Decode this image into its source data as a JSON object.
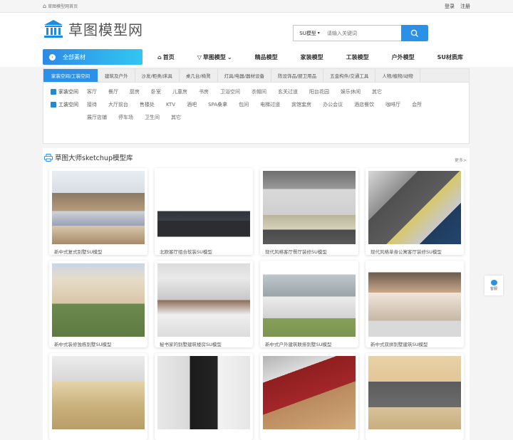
{
  "topbar": {
    "home_link": "草图模型网首页",
    "login": "登录",
    "register": "注册"
  },
  "header": {
    "logo_text": "草图模型网"
  },
  "search": {
    "category": "SU模型",
    "placeholder": "请输入关键词"
  },
  "nav": {
    "all_materials": "全部素材",
    "links": [
      "首页",
      "草图模型",
      "精品模型",
      "家装模型",
      "工装模型",
      "户外模型",
      "SU材质库"
    ]
  },
  "category_tabs": [
    "家装空间/工装空间",
    "建筑及户外",
    "沙发/柜类/床具",
    "桌几台/椅凳",
    "灯具/电器/器材设备",
    "陈设饰品/厨卫用品",
    "五金构件/交通工具",
    "人物/植物/动物"
  ],
  "category_panel": {
    "home": {
      "label": "家装空间",
      "items": [
        "客厅",
        "餐厅",
        "厨房",
        "卧室",
        "儿童房",
        "书房",
        "卫浴空间",
        "衣帽间",
        "玄关过道",
        "阳台花园",
        "娱乐休闲",
        "其它"
      ]
    },
    "work": {
      "label": "工装空间",
      "items": [
        "接待",
        "大厅前台",
        "售楼处",
        "KTV",
        "酒吧",
        "SPA桑拿",
        "包间",
        "电梯过道",
        "宾馆套房",
        "办公会议",
        "酒店餐饮",
        "咖啡厅",
        "会所",
        "展厅店铺",
        "停车场",
        "卫生间",
        "其它"
      ]
    }
  },
  "section": {
    "title": "草图大师sketchup模型库",
    "more": "更多>",
    "cards": [
      {
        "caption": "新中式复式别墅SU模型",
        "scene": "living-room-chinese"
      },
      {
        "caption": "北欧客厅组合软装SU模型",
        "scene": "nordic-sofa"
      },
      {
        "caption": "现代风格客厅餐厅装修SU模型",
        "scene": "modern-living"
      },
      {
        "caption": "现代风格单身公寓客厅装修SU模型",
        "scene": "apartment"
      },
      {
        "caption": "新中式装修独栋别墅SU模型",
        "scene": "villa-1"
      },
      {
        "caption": "秘书家的别墅建筑楼房SU模型",
        "scene": "villa-2"
      },
      {
        "caption": "新中式户外建筑联排别墅SU模型",
        "scene": "villa-3"
      },
      {
        "caption": "新中式双拼别墅建筑SU模型",
        "scene": "villa-4"
      },
      {
        "caption": "",
        "scene": "classroom"
      },
      {
        "caption": "",
        "scene": "gallery"
      },
      {
        "caption": "",
        "scene": "reception"
      },
      {
        "caption": "",
        "scene": "office"
      }
    ]
  },
  "feedback": {
    "label": "客服"
  },
  "colors": {
    "accent": "#2b90e7",
    "accent_light": "#32c7f2"
  }
}
